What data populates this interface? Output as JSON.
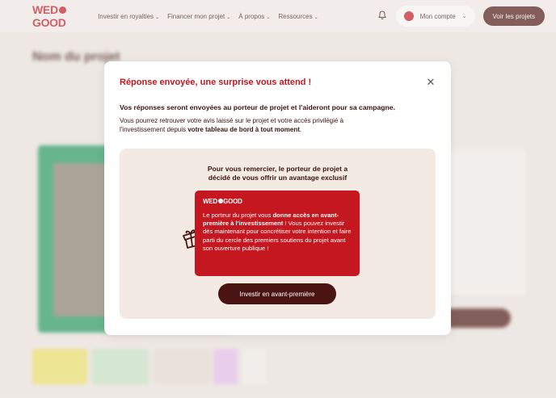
{
  "navbar": {
    "logo": "WEDOGOOD",
    "items": [
      {
        "label": "Investir en royalties"
      },
      {
        "label": "Financer mon projet"
      },
      {
        "label": "À propos"
      },
      {
        "label": "Ressources"
      }
    ],
    "account_label": "Mon compte",
    "projects_button": "Voir les projets"
  },
  "background": {
    "project_title": "Nom du projet"
  },
  "modal": {
    "title": "Réponse envoyée, une surprise vous attend !",
    "lead": "Vos réponses seront envoyées au porteur de projet et l'aideront pour sa campagne.",
    "body_line1": "Vous pourrez retrouver votre avis laissé sur le projet et votre accès privilégié à",
    "body_line2_start": "l'investissement depuis ",
    "body_line2_bold": "votre tableau de bord à tout moment",
    "body_line2_end": ".",
    "panel": {
      "intro_line1": "Pour vous remercier, le porteur de projet a",
      "intro_line2": "décidé de vous offrir un avantage exclusif",
      "card_logo": "WEDOGOOD",
      "card_text_start": "Le porteur du projet vous ",
      "card_text_bold": "donne accès en avant-première à l'investissement",
      "card_text_mid": " ! Vous pouvez investir dès maintenant pour concrétiser votre intention et faire parti du cercle des premiers soutiens du projet avant son ouverture publique !",
      "cta": "Investir en avant-première"
    }
  },
  "colors": {
    "brand_red": "#c4171f",
    "dark_brown": "#4a1412",
    "panel_beige": "#f3ebe3"
  },
  "icons": {
    "bell": "bell-icon",
    "close": "close-icon",
    "gift": "gift-icon"
  }
}
